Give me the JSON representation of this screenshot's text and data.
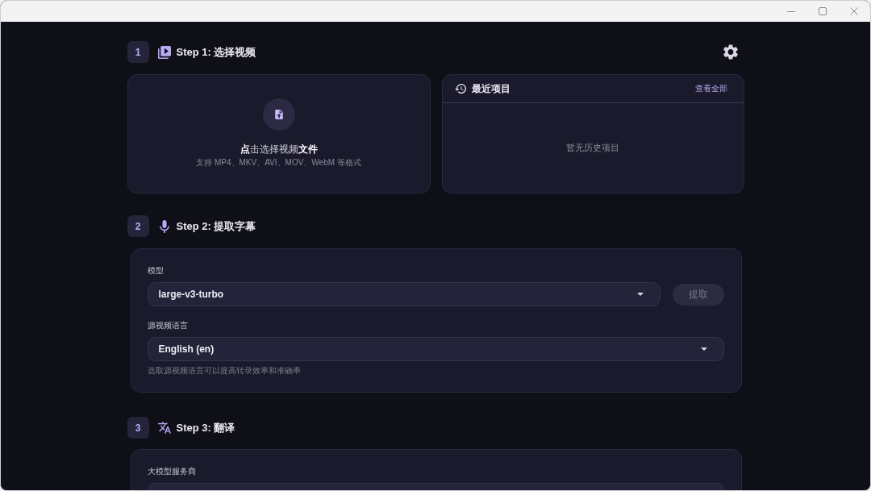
{
  "video_step": {
    "number": "1",
    "title": "Step 1: 选择视频",
    "upload": {
      "prompt": "**点**击选择视频**文件**",
      "hint": "支持 MP4、MKV、AVI、MOV、WebM 等格式"
    },
    "recent": {
      "title": "最近项目",
      "link": "查看全部",
      "empty": "暂无历史项目"
    }
  },
  "subtitle_step": {
    "number": "2",
    "title": "Step 2: 提取字幕",
    "model": {
      "label": "模型",
      "value": "large-v3-turbo"
    },
    "extract_button": {
      "label": "提取",
      "disabled": true
    },
    "language": {
      "label": "源视频语言",
      "value": "English (en)",
      "help": "选取源视频语言可以提高转录效率和准确率"
    }
  },
  "translate_step": {
    "number": "3",
    "title": "Step 3: 翻译",
    "provider": {
      "label": "大模型服务商"
    }
  }
}
